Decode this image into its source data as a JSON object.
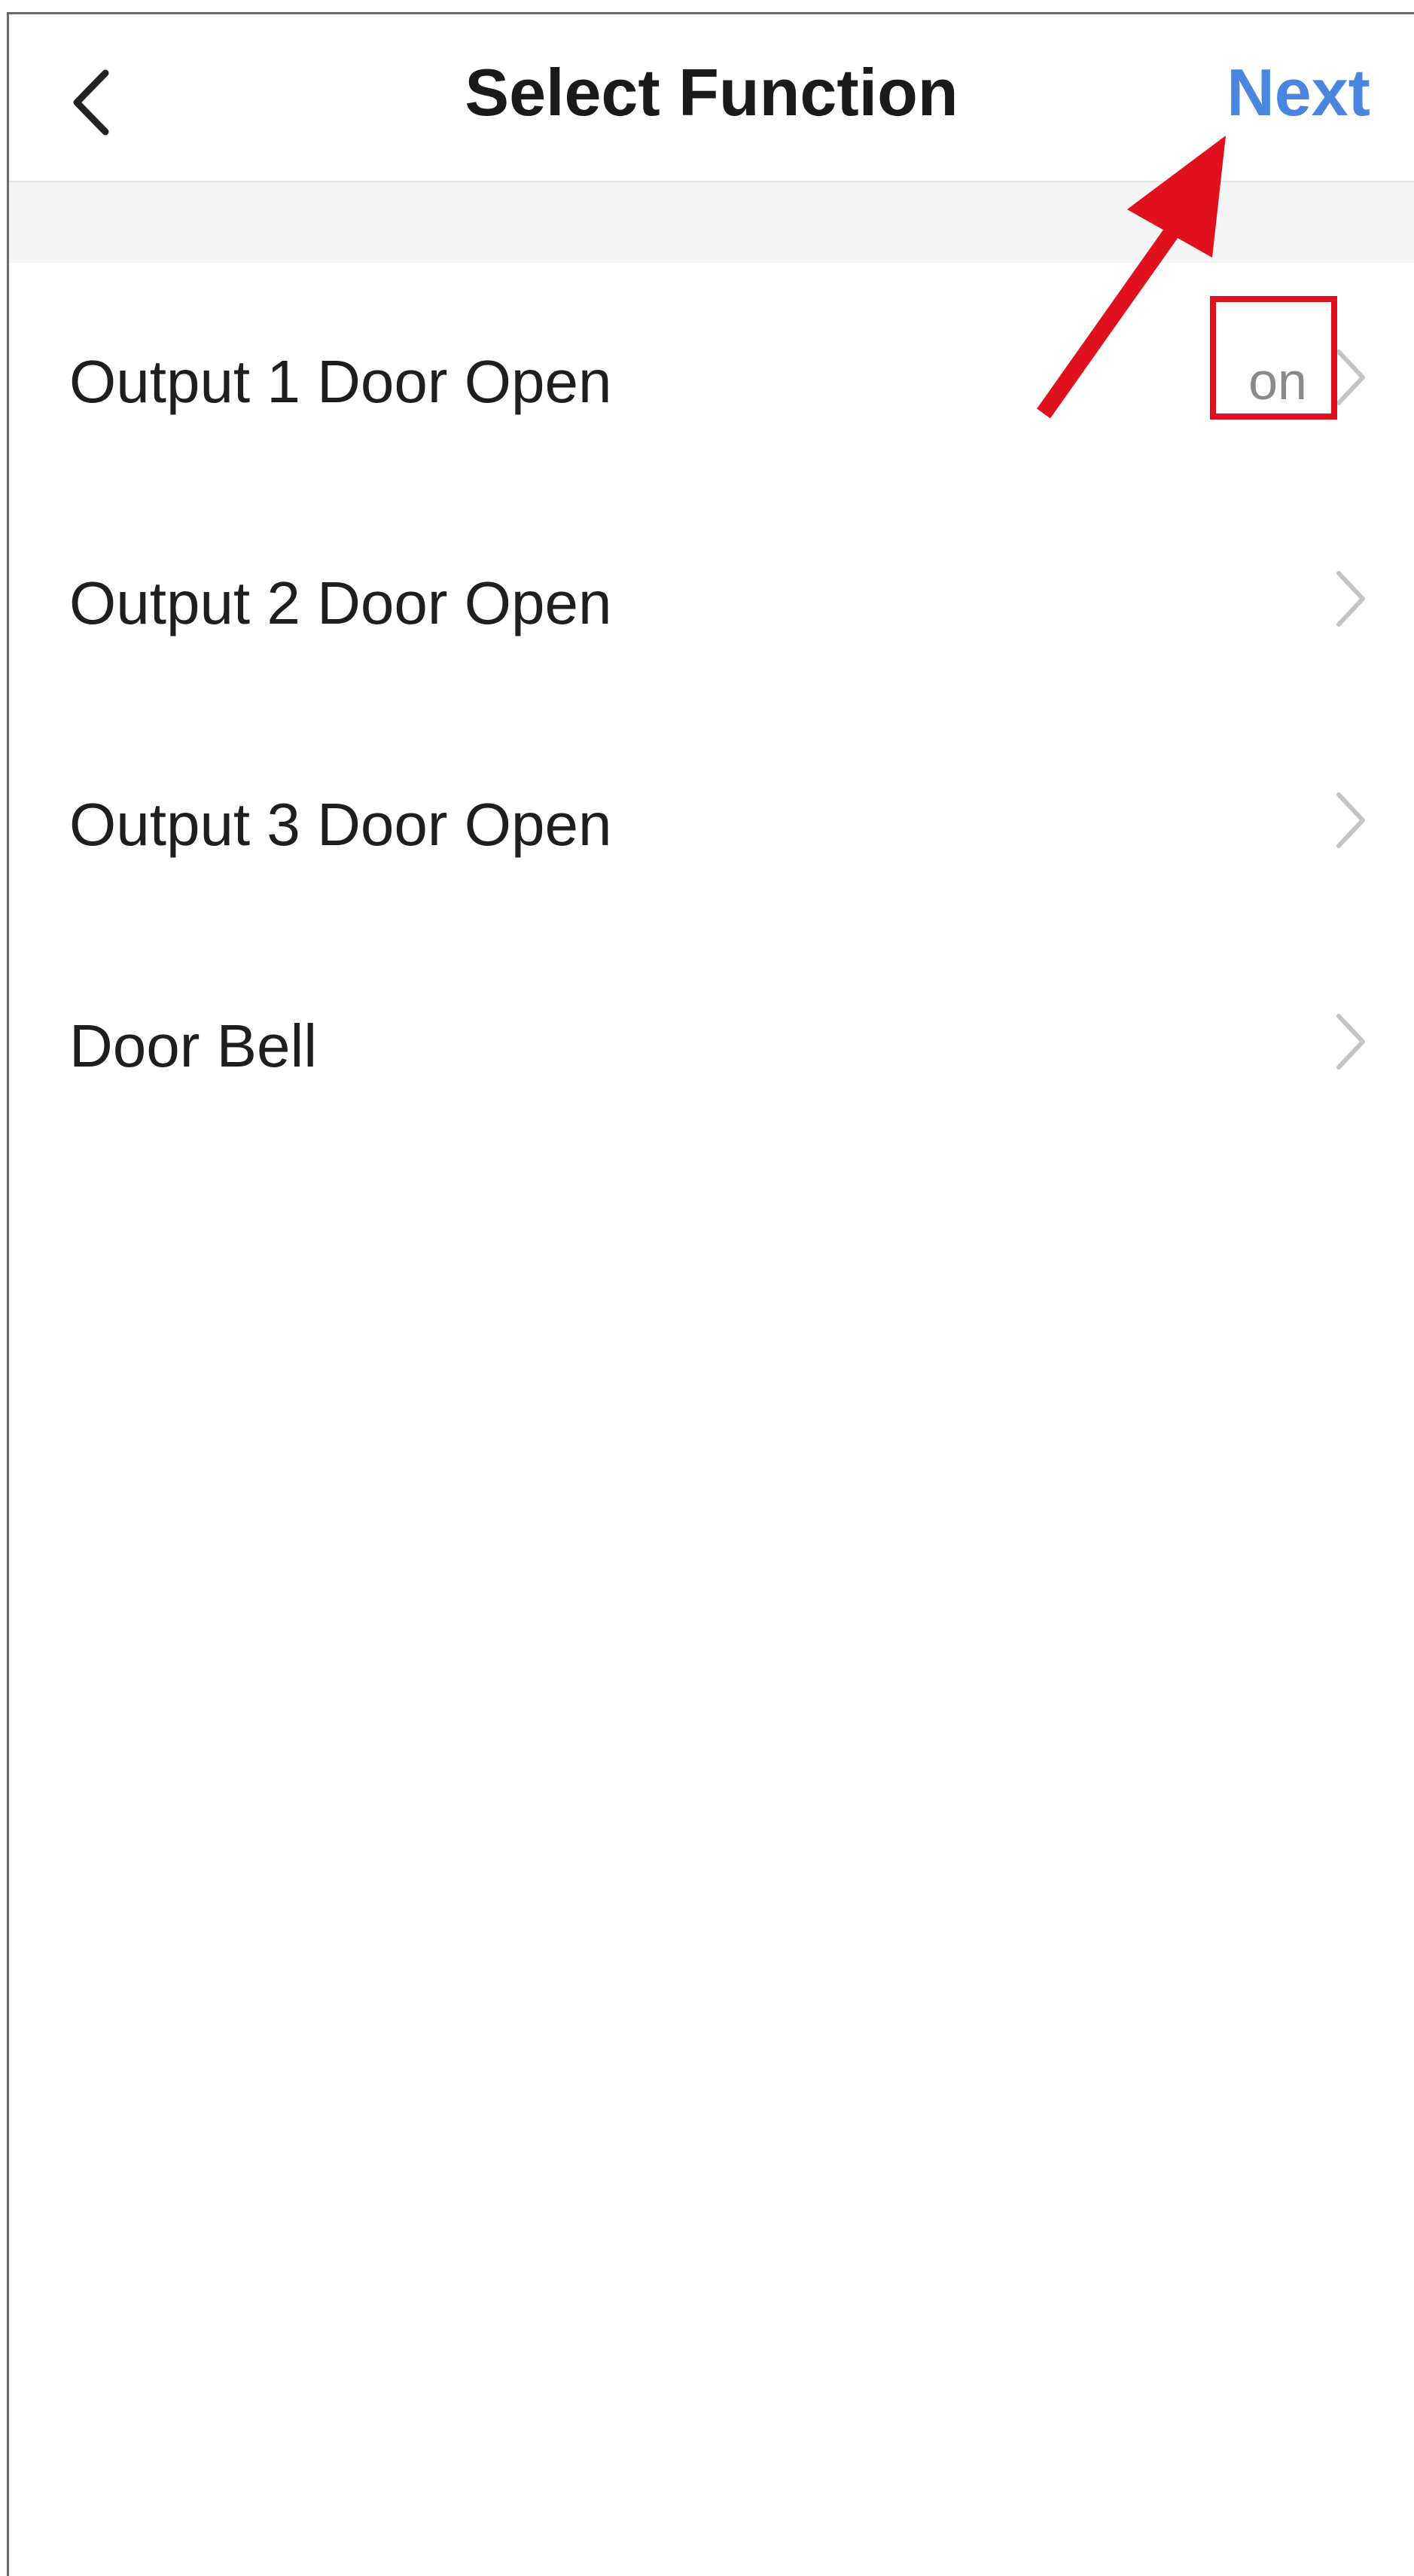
{
  "header": {
    "title": "Select Function",
    "next_label": "Next"
  },
  "functions": [
    {
      "label": "Output 1 Door Open",
      "value": "on"
    },
    {
      "label": "Output 2 Door Open",
      "value": ""
    },
    {
      "label": "Output 3 Door Open",
      "value": ""
    },
    {
      "label": "Door Bell",
      "value": ""
    }
  ],
  "colors": {
    "accent": "#4a86e0",
    "annotation": "#e0101e",
    "secondary_text": "#8a8a8a",
    "chevron": "#c4c4c4"
  },
  "icons": {
    "back": "chevron-left-icon",
    "row": "chevron-right-icon"
  }
}
